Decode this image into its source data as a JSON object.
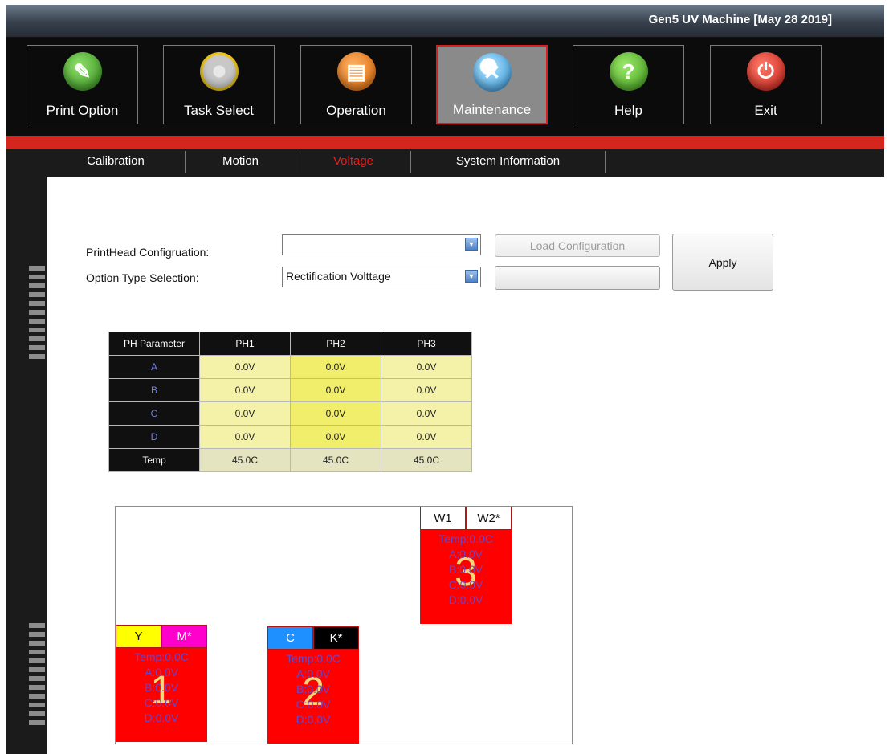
{
  "window": {
    "title": "Gen5 UV Machine [May 28 2019]"
  },
  "toolbar": {
    "buttons": [
      {
        "label": "Print Option",
        "icon": "print-option-icon",
        "color": "#3f9c25"
      },
      {
        "label": "Task Select",
        "icon": "disc-icon",
        "color": "#e5c226"
      },
      {
        "label": "Operation",
        "icon": "printer-icon",
        "color": "#e57a16"
      },
      {
        "label": "Maintenance",
        "icon": "tools-icon",
        "color": "#3aa0e0",
        "active": true
      },
      {
        "label": "Help",
        "icon": "help-icon",
        "color": "#58b52a",
        "glyph": "?"
      },
      {
        "label": "Exit",
        "icon": "power-icon",
        "color": "#d8241e",
        "glyph": "⏻"
      }
    ]
  },
  "tabs": [
    {
      "label": "Calibration"
    },
    {
      "label": "Motion"
    },
    {
      "label": "Voltage",
      "active": true
    },
    {
      "label": "System Information"
    }
  ],
  "form": {
    "printhead_label": "PrintHead Configruation:",
    "printhead_value": "",
    "option_label": "Option  Type Selection:",
    "option_value": "Rectification Volttage",
    "load_button": "Load Configuration",
    "empty_button": "",
    "apply_button": "Apply"
  },
  "table": {
    "headers": [
      "PH Parameter",
      "PH1",
      "PH2",
      "PH3"
    ],
    "rows": [
      {
        "name": "A",
        "values": [
          "0.0V",
          "0.0V",
          "0.0V"
        ]
      },
      {
        "name": "B",
        "values": [
          "0.0V",
          "0.0V",
          "0.0V"
        ]
      },
      {
        "name": "C",
        "values": [
          "0.0V",
          "0.0V",
          "0.0V"
        ]
      },
      {
        "name": "D",
        "values": [
          "0.0V",
          "0.0V",
          "0.0V"
        ]
      }
    ],
    "temp_row": {
      "name": "Temp",
      "values": [
        "45.0C",
        "45.0C",
        "45.0C"
      ]
    }
  },
  "heads": [
    {
      "number": "1",
      "colors": [
        {
          "label": "Y",
          "bg": "#ffff00",
          "fg": "#111111"
        },
        {
          "label": "M*",
          "bg": "#ff00cc",
          "fg": "#ffffff"
        }
      ],
      "lines": [
        "Temp:0.0C",
        "A:0.0V",
        "B:0.0V",
        "C:0.0V",
        "D:0.0V"
      ]
    },
    {
      "number": "2",
      "colors": [
        {
          "label": "C",
          "bg": "#1e90ff",
          "fg": "#ffffff"
        },
        {
          "label": "K*",
          "bg": "#000000",
          "fg": "#ffffff"
        }
      ],
      "lines": [
        "Temp:0.0C",
        "A:0.0V",
        "B:0.0V",
        "C:0.0V",
        "D:0.0V"
      ]
    },
    {
      "number": "3",
      "colors": [
        {
          "label": "W1",
          "bg": "#ffffff",
          "fg": "#111111"
        },
        {
          "label": "W2*",
          "bg": "#ffffff",
          "fg": "#111111"
        }
      ],
      "lines": [
        "Temp:0.0C",
        "A:0.0V",
        "B:0.0V",
        "C:0.0V",
        "D:0.0V"
      ]
    }
  ]
}
